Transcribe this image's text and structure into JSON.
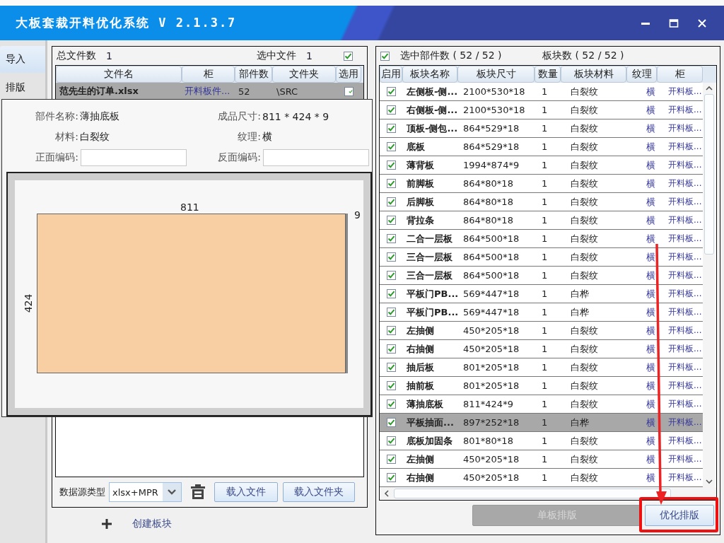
{
  "window": {
    "title": "大板套裁开料优化系统 V 2.1.3.7"
  },
  "sidebar": {
    "tabs": [
      {
        "label": "导入",
        "selected": true
      },
      {
        "label": "排版",
        "selected": false
      }
    ]
  },
  "file_panel": {
    "total_files_label": "总文件数",
    "total_files": "1",
    "selected_files_label": "选中文件",
    "selected_files": "1",
    "all_checked": true,
    "columns": [
      "文件名",
      "柜",
      "部件数",
      "文件夹",
      "选用"
    ],
    "rows": [
      {
        "file_name": "范先生的订单.xlsx",
        "cabinet": "开料板件...",
        "parts": "52",
        "folder": "\\SRC",
        "checked": true,
        "selected": true
      }
    ],
    "source_type_label": "数据源类型",
    "source_type": "xlsx+MPR",
    "buttons": [
      "载入文件",
      "载入文件夹"
    ]
  },
  "create_block": "创建板块",
  "part_popup": {
    "info": [
      {
        "label": "部件名称:",
        "value": "薄抽底板"
      },
      {
        "label": "成品尺寸:",
        "value": "811 * 424 * 9"
      },
      {
        "label": "材料:",
        "value": "白裂纹"
      },
      {
        "label": "纹理:",
        "value": "横"
      }
    ],
    "codes": [
      {
        "label": "正面编码:"
      },
      {
        "label": "反面编码:"
      }
    ],
    "preview": {
      "width_label": "811",
      "height_label": "424",
      "thickness_label": "9"
    }
  },
  "parts_panel": {
    "all_checked": true,
    "selected_parts": "选中部件数 ( 52 / 52 )",
    "block_count": "板块数 ( 52 / 52 )",
    "columns": [
      "启用",
      "板块名称",
      "板块尺寸",
      "数量",
      "板块材料",
      "纹理",
      "柜"
    ],
    "rows": [
      {
        "name": "左侧板-侧...",
        "size": "2100*530*18",
        "qty": "1",
        "material": "白裂纹",
        "grain": "横",
        "cabinet": "开料板...",
        "checked": true,
        "selected": false
      },
      {
        "name": "右侧板-侧...",
        "size": "2100*530*18",
        "qty": "1",
        "material": "白裂纹",
        "grain": "横",
        "cabinet": "开料板...",
        "checked": true,
        "selected": false
      },
      {
        "name": "顶板-侧包...",
        "size": "864*529*18",
        "qty": "1",
        "material": "白裂纹",
        "grain": "横",
        "cabinet": "开料板...",
        "checked": true,
        "selected": false
      },
      {
        "name": "底板",
        "size": "864*529*18",
        "qty": "1",
        "material": "白裂纹",
        "grain": "横",
        "cabinet": "开料板...",
        "checked": true,
        "selected": false
      },
      {
        "name": "薄背板",
        "size": "1994*874*9",
        "qty": "1",
        "material": "白裂纹",
        "grain": "横",
        "cabinet": "开料板...",
        "checked": true,
        "selected": false
      },
      {
        "name": "前脚板",
        "size": "864*80*18",
        "qty": "1",
        "material": "白裂纹",
        "grain": "横",
        "cabinet": "开料板...",
        "checked": true,
        "selected": false
      },
      {
        "name": "后脚板",
        "size": "864*80*18",
        "qty": "1",
        "material": "白裂纹",
        "grain": "横",
        "cabinet": "开料板...",
        "checked": true,
        "selected": false
      },
      {
        "name": "背拉条",
        "size": "864*80*18",
        "qty": "1",
        "material": "白裂纹",
        "grain": "横",
        "cabinet": "开料板...",
        "checked": true,
        "selected": false
      },
      {
        "name": "二合一层板",
        "size": "864*500*18",
        "qty": "1",
        "material": "白裂纹",
        "grain": "横",
        "cabinet": "开料板...",
        "checked": true,
        "selected": false
      },
      {
        "name": "三合一层板",
        "size": "864*500*18",
        "qty": "1",
        "material": "白裂纹",
        "grain": "横",
        "cabinet": "开料板...",
        "checked": true,
        "selected": false
      },
      {
        "name": "三合一层板",
        "size": "864*500*18",
        "qty": "1",
        "material": "白裂纹",
        "grain": "横",
        "cabinet": "开料板...",
        "checked": true,
        "selected": false
      },
      {
        "name": "平板门PB...",
        "size": "569*447*18",
        "qty": "1",
        "material": "白桦",
        "grain": "横",
        "cabinet": "开料板...",
        "checked": true,
        "selected": false
      },
      {
        "name": "平板门PB...",
        "size": "569*447*18",
        "qty": "1",
        "material": "白桦",
        "grain": "横",
        "cabinet": "开料板...",
        "checked": true,
        "selected": false
      },
      {
        "name": "左抽侧",
        "size": "450*205*18",
        "qty": "1",
        "material": "白裂纹",
        "grain": "横",
        "cabinet": "开料板...",
        "checked": true,
        "selected": false
      },
      {
        "name": "右抽侧",
        "size": "450*205*18",
        "qty": "1",
        "material": "白裂纹",
        "grain": "横",
        "cabinet": "开料板...",
        "checked": true,
        "selected": false
      },
      {
        "name": "抽后板",
        "size": "801*205*18",
        "qty": "1",
        "material": "白裂纹",
        "grain": "横",
        "cabinet": "开料板...",
        "checked": true,
        "selected": false
      },
      {
        "name": "抽前板",
        "size": "801*205*18",
        "qty": "1",
        "material": "白裂纹",
        "grain": "横",
        "cabinet": "开料板...",
        "checked": true,
        "selected": false
      },
      {
        "name": "薄抽底板",
        "size": "811*424*9",
        "qty": "1",
        "material": "白裂纹",
        "grain": "横",
        "cabinet": "开料板...",
        "checked": true,
        "selected": false
      },
      {
        "name": "平板抽面...",
        "size": "897*252*18",
        "qty": "1",
        "material": "白桦",
        "grain": "横",
        "cabinet": "开料板...",
        "checked": true,
        "selected": true
      },
      {
        "name": "底板加固条",
        "size": "801*80*18",
        "qty": "1",
        "material": "白裂纹",
        "grain": "横",
        "cabinet": "开料板...",
        "checked": true,
        "selected": false
      },
      {
        "name": "左抽侧",
        "size": "450*205*18",
        "qty": "1",
        "material": "白裂纹",
        "grain": "横",
        "cabinet": "开料板...",
        "checked": true,
        "selected": false
      },
      {
        "name": "右抽侧",
        "size": "450*205*18",
        "qty": "1",
        "material": "白裂纹",
        "grain": "横",
        "cabinet": "开料板...",
        "checked": true,
        "selected": false
      }
    ]
  },
  "buttons": [
    {
      "label": "单板排版",
      "disabled": true,
      "highlighted": false
    },
    {
      "label": "优化排版",
      "disabled": false,
      "highlighted": true
    }
  ]
}
